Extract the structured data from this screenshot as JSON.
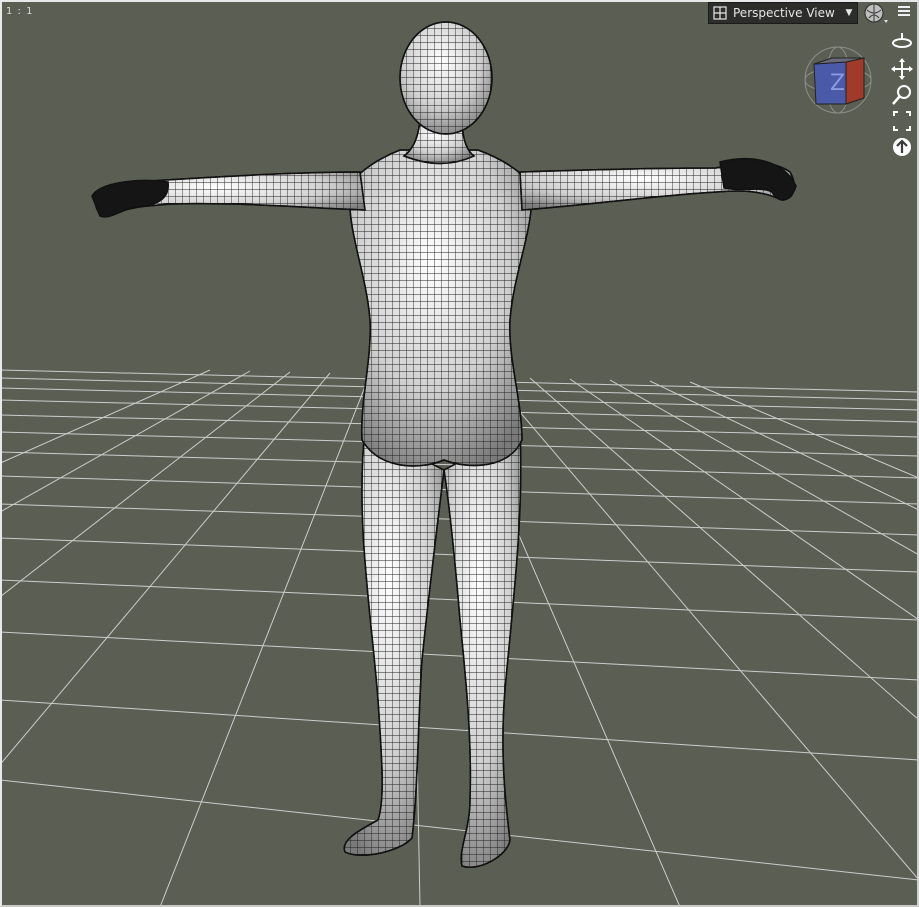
{
  "viewport": {
    "zoom_ratio": "1 : 1",
    "view_name": "Perspective View",
    "background_color": "#5b5e53",
    "grid_color": "#d9d9d9"
  },
  "toolbar": {
    "view_dropdown_icon": "viewport-layout-icon",
    "dropdown_arrow": "▼",
    "render_icon": "draw-style-sphere-icon",
    "menu_icon": "viewport-menu-icon"
  },
  "nav_tools": [
    {
      "name": "orbit-icon"
    },
    {
      "name": "pan-icon"
    },
    {
      "name": "zoom-icon"
    },
    {
      "name": "frame-icon"
    },
    {
      "name": "reset-view-icon"
    }
  ],
  "cube_widget": {
    "icon": "view-cube-icon",
    "face_color": "#4a5aa8",
    "side_color": "#a03a2a"
  }
}
